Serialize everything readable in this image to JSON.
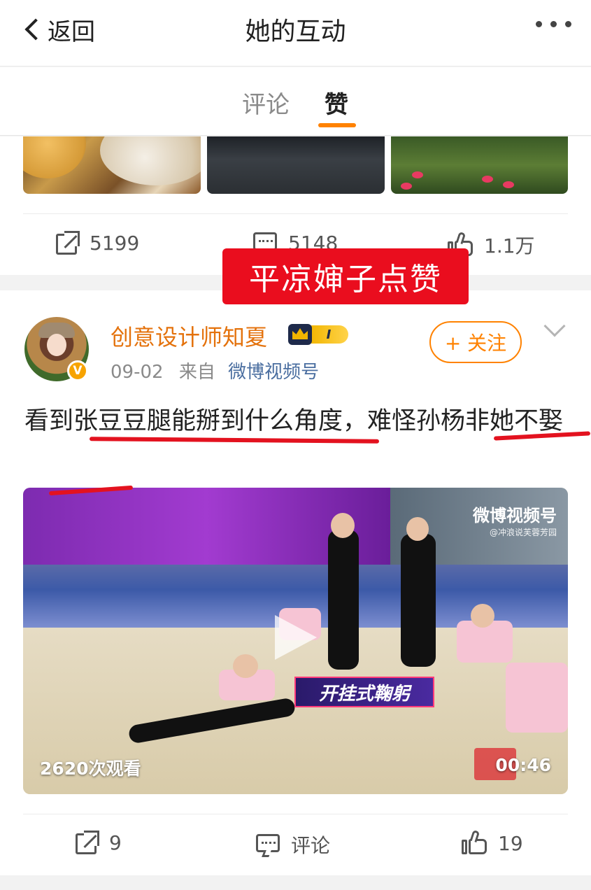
{
  "nav": {
    "back_label": "返回",
    "title": "她的互动"
  },
  "tabs": [
    {
      "label": "评论",
      "active": false
    },
    {
      "label": "赞",
      "active": true
    }
  ],
  "colors": {
    "accent": "#ff8200",
    "username": "#e4720c",
    "source_link": "#4a6ea0",
    "overlay_red": "#ea0d1e"
  },
  "post1": {
    "share_count": "5199",
    "comment_count": "5148",
    "like_count": "1.1万"
  },
  "overlay_label": "平凉婶子点赞",
  "post2": {
    "username": "创意设计师知夏",
    "verified_badge": "V",
    "member_level": "I",
    "date": "09-02",
    "source_prefix": "来自",
    "source": "微博视频号",
    "follow_label": "+ 关注",
    "text": "看到张豆豆腿能掰到什么角度，难怪孙杨非她不娶",
    "video": {
      "watermark": "微博视频号",
      "watermark_sub": "@冲浪说芙蓉芳园",
      "banner": "开挂式鞠躬",
      "views": "2620次观看",
      "duration": "00:46"
    },
    "share_count": "9",
    "comment_label": "评论",
    "like_count": "19"
  }
}
